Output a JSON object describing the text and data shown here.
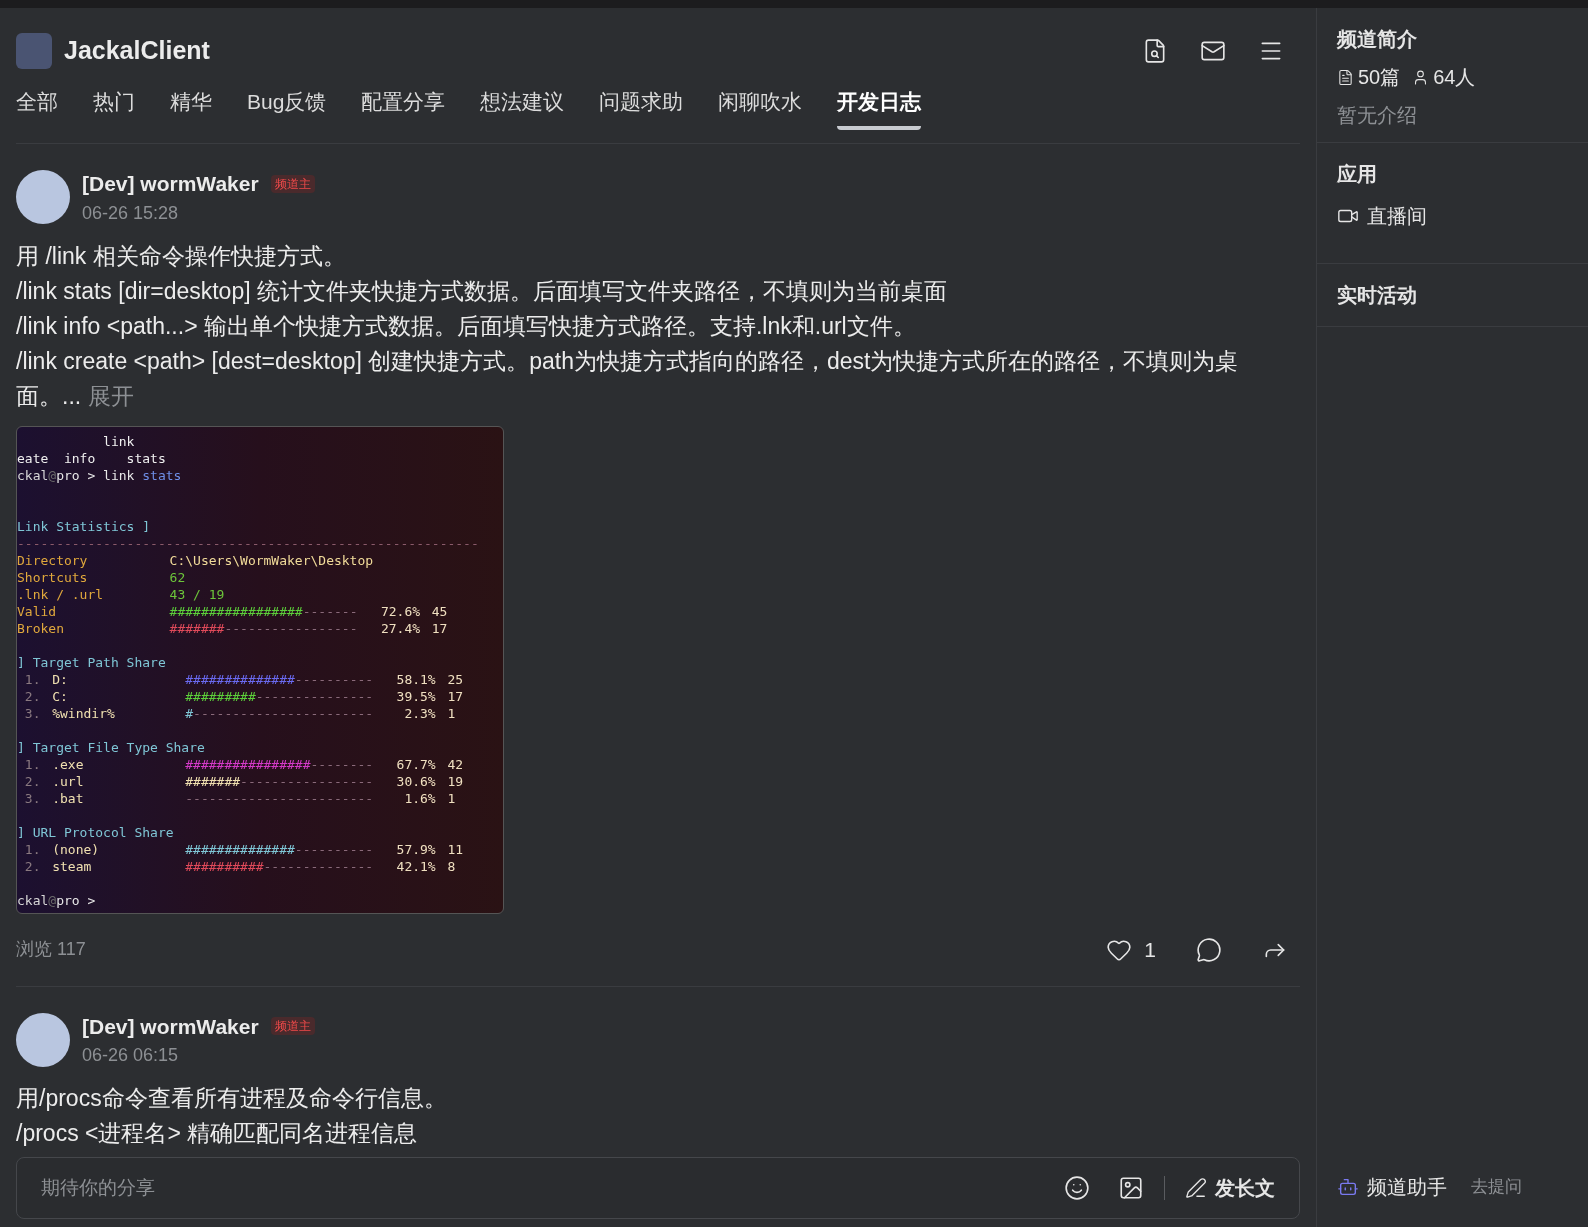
{
  "channel": {
    "name": "JackalClient"
  },
  "tabs": [
    {
      "label": "全部",
      "selected": false
    },
    {
      "label": "热门",
      "selected": false
    },
    {
      "label": "精华",
      "selected": false
    },
    {
      "label": "Bug反馈",
      "selected": false
    },
    {
      "label": "配置分享",
      "selected": false
    },
    {
      "label": "想法建议",
      "selected": false
    },
    {
      "label": "问题求助",
      "selected": false
    },
    {
      "label": "闲聊吹水",
      "selected": false
    },
    {
      "label": "开发日志",
      "selected": true
    }
  ],
  "posts": [
    {
      "author": "[Dev] wormWaker",
      "badge": "频道主",
      "time": "06-26 15:28",
      "paragraphs": [
        "用 /link 相关命令操作快捷方式。",
        "/link stats [dir=desktop] 统计文件夹快捷方式数据。后面填写文件夹路径，不填则为当前桌面",
        "/link info <path...> 输出单个快捷方式数据。后面填写快捷方式路径。支持.lnk和.url文件。",
        "/link create <path> [dest=desktop] 创建快捷方式。path为快捷方式指向的路径，dest为快捷方式所在的路径，不填则为桌面。..."
      ],
      "expand": "展开",
      "terminal": {
        "lines": [
          {
            "kind": "text",
            "segments": [
              {
                "text": "           link",
                "color": "#f0f0f0"
              }
            ]
          },
          {
            "kind": "text",
            "segments": [
              {
                "text": "eate  info    stats",
                "color": "#f0f0f0"
              }
            ]
          },
          {
            "kind": "text",
            "segments": [
              {
                "text": "ckal",
                "color": "#d8d8d8"
              },
              {
                "text": "@",
                "color": "#6a6a6a"
              },
              {
                "text": "pro > link ",
                "color": "#e8e8e8"
              },
              {
                "text": "stats",
                "color": "#6f8fe8"
              }
            ]
          },
          {
            "kind": "blank"
          },
          {
            "kind": "blank"
          },
          {
            "kind": "text",
            "segments": [
              {
                "text": "Link Statistics ]",
                "color": "#7fc6d6"
              }
            ]
          },
          {
            "kind": "text",
            "segments": [
              {
                "text": "-----------------------------------------------------------",
                "color": "#8a5a6a"
              }
            ]
          },
          {
            "kind": "pair",
            "key": "Directory",
            "value": "C:\\Users\\WormWaker\\Desktop",
            "color": "#f2dc9a"
          },
          {
            "kind": "pair",
            "key": "Shortcuts",
            "value": "62",
            "color": "#6cc43a"
          },
          {
            "kind": "pair",
            "key": ".lnk / .url",
            "value": "43 / 19",
            "color": "#6cc43a"
          },
          {
            "kind": "bar",
            "label": "Valid",
            "filled": "#################",
            "empty": "-------",
            "percent": "72.6%",
            "count": "45",
            "color": "#5ccf3a"
          },
          {
            "kind": "bar",
            "label": "Broken",
            "filled": "#######",
            "empty": "-----------------",
            "percent": "27.4%",
            "count": "17",
            "color": "#e04a5a"
          },
          {
            "kind": "blank"
          },
          {
            "kind": "text",
            "segments": [
              {
                "text": "] Target Path Share",
                "color": "#7fc6d6"
              }
            ]
          },
          {
            "kind": "item",
            "index": "1.",
            "label": "D:",
            "filled": "##############",
            "empty": "----------",
            "percent": "58.1%",
            "count": "25",
            "color": "#6a6af0"
          },
          {
            "kind": "item",
            "index": "2.",
            "label": "C:",
            "filled": "#########",
            "empty": "---------------",
            "percent": "39.5%",
            "count": "17",
            "color": "#5ccf3a"
          },
          {
            "kind": "item",
            "index": "3.",
            "label": "%windir%",
            "filled": "#",
            "empty": "-----------------------",
            "percent": "2.3%",
            "count": "1",
            "color": "#7fc6d6"
          },
          {
            "kind": "blank"
          },
          {
            "kind": "text",
            "segments": [
              {
                "text": "] Target File Type Share",
                "color": "#7fc6d6"
              }
            ]
          },
          {
            "kind": "item",
            "index": "1.",
            "label": ".exe",
            "filled": "################",
            "empty": "--------",
            "percent": "67.7%",
            "count": "42",
            "color": "#d43ac8"
          },
          {
            "kind": "item",
            "index": "2.",
            "label": ".url",
            "filled": "#######",
            "empty": "-----------------",
            "percent": "30.6%",
            "count": "19",
            "color": "#f0e0b0"
          },
          {
            "kind": "item",
            "index": "3.",
            "label": ".bat",
            "empty": "------------------------",
            "percent": "1.6%",
            "count": "1",
            "color": "#8a6a7a"
          },
          {
            "kind": "blank"
          },
          {
            "kind": "text",
            "segments": [
              {
                "text": "] URL Protocol Share",
                "color": "#7fc6d6"
              }
            ]
          },
          {
            "kind": "item",
            "index": "1.",
            "label": "(none)",
            "filled": "##############",
            "empty": "----------",
            "percent": "57.9%",
            "count": "11",
            "color": "#7fc6d6"
          },
          {
            "kind": "item",
            "index": "2.",
            "label": "steam",
            "filled": "##########",
            "empty": "--------------",
            "percent": "42.1%",
            "count": "8",
            "color": "#e04a5a"
          },
          {
            "kind": "blank"
          },
          {
            "kind": "text",
            "segments": [
              {
                "text": "ckal",
                "color": "#d8d8d8"
              },
              {
                "text": "@",
                "color": "#6a6a6a"
              },
              {
                "text": "pro >",
                "color": "#e8e8e8"
              }
            ]
          }
        ]
      },
      "views": "浏览 117",
      "likes": "1"
    },
    {
      "author": "[Dev] wormWaker",
      "badge": "频道主",
      "time": "06-26 06:15",
      "paragraphs": [
        "用/procs命令查看所有进程及命令行信息。",
        "/procs <进程名> 精确匹配同名进程信息"
      ]
    }
  ],
  "composer": {
    "placeholder": "期待你的分享",
    "long_post": "发长文"
  },
  "sidebar": {
    "intro_title": "频道简介",
    "posts": "50篇",
    "members": "64人",
    "intro": "暂无介绍",
    "apps_title": "应用",
    "apps": [
      "直播间"
    ],
    "activity_title": "实时活动",
    "assistant": "频道助手",
    "ask": "去提问"
  }
}
